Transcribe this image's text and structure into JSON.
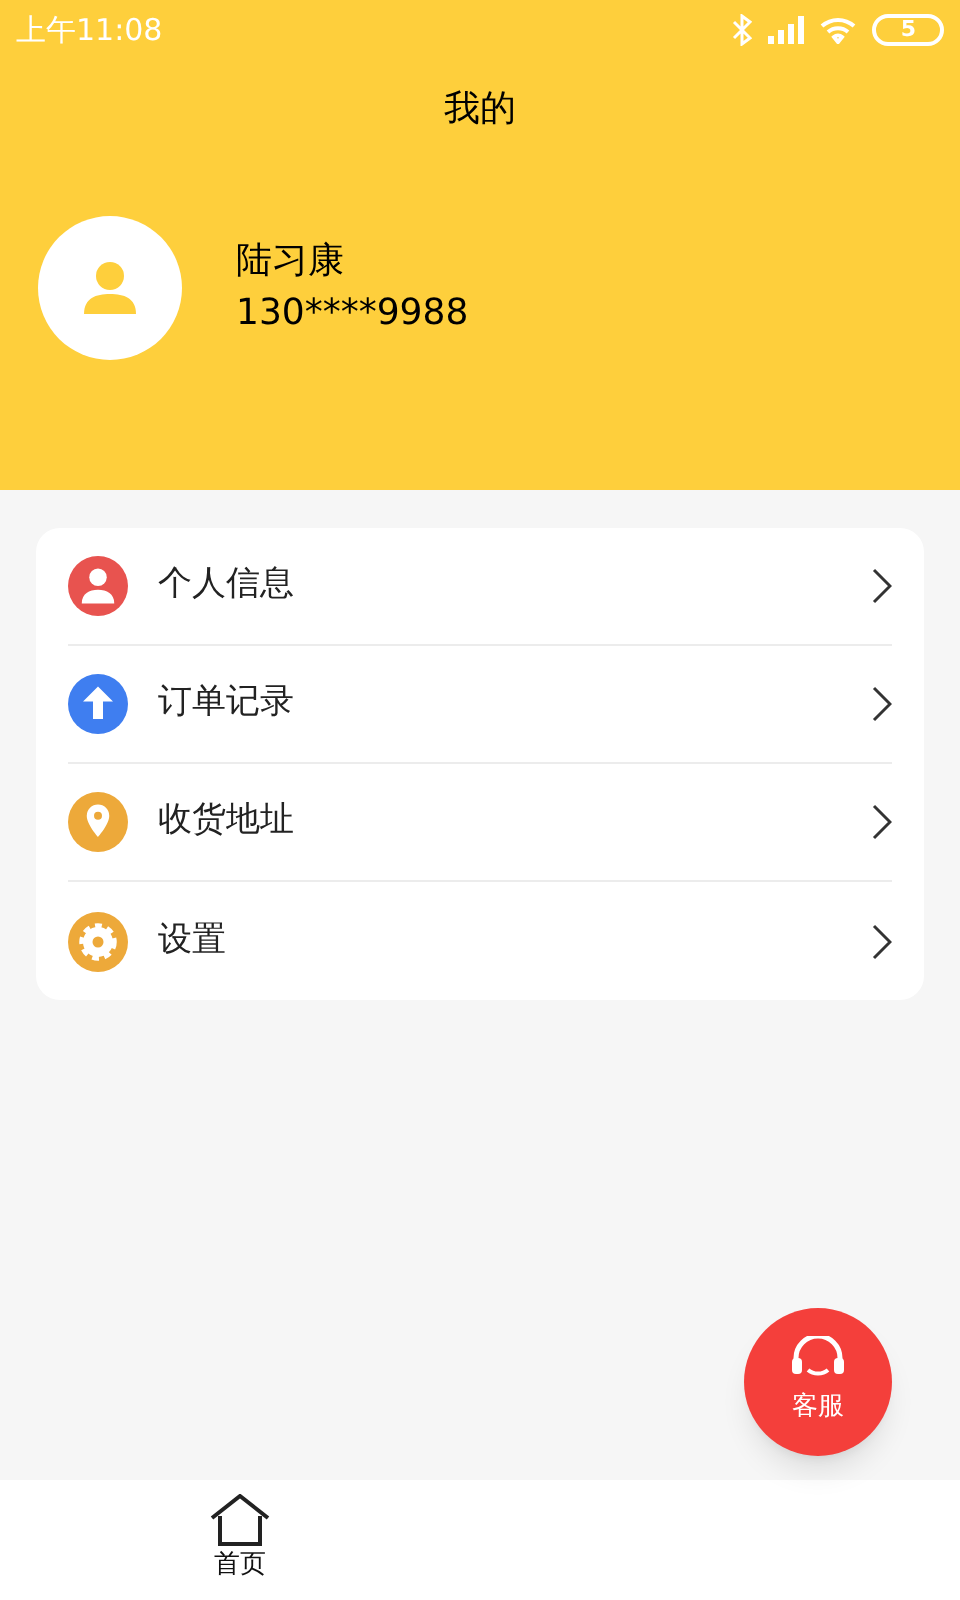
{
  "status_bar": {
    "time": "上午11:08",
    "battery": "5"
  },
  "header": {
    "title": "我的",
    "user_name": "陆习康",
    "phone": "130****9988"
  },
  "menu": [
    {
      "kind": "person",
      "label": "个人信息",
      "color": "#e8534f"
    },
    {
      "kind": "upload",
      "label": "订单记录",
      "color": "#3f7ef0"
    },
    {
      "kind": "pin",
      "label": "收货地址",
      "color": "#eda93a"
    },
    {
      "kind": "gear",
      "label": "设置",
      "color": "#eda93a"
    }
  ],
  "support_button": {
    "label": "客服"
  },
  "bottom_nav": [
    {
      "label": "首页"
    }
  ]
}
